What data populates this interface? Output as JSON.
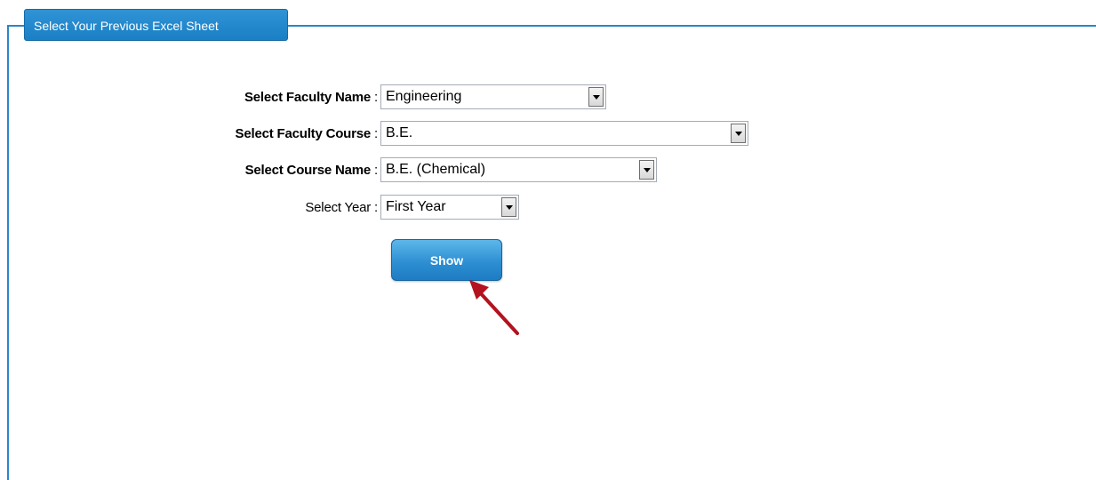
{
  "panel": {
    "legend": "Select Your Previous Excel Sheet"
  },
  "form": {
    "faculty_name": {
      "label": "Select Faculty Name",
      "separator": " :",
      "value": "Engineering"
    },
    "faculty_course": {
      "label": "Select Faculty Course",
      "separator": " :",
      "value": "B.E."
    },
    "course_name": {
      "label": "Select Course Name",
      "separator": " :",
      "value": "B.E. (Chemical)"
    },
    "year": {
      "label": "Select Year",
      "separator": " :",
      "value": "First Year"
    }
  },
  "actions": {
    "show_label": "Show"
  },
  "colors": {
    "accent": "#2a86c8",
    "annotation_arrow": "#b3121e"
  }
}
